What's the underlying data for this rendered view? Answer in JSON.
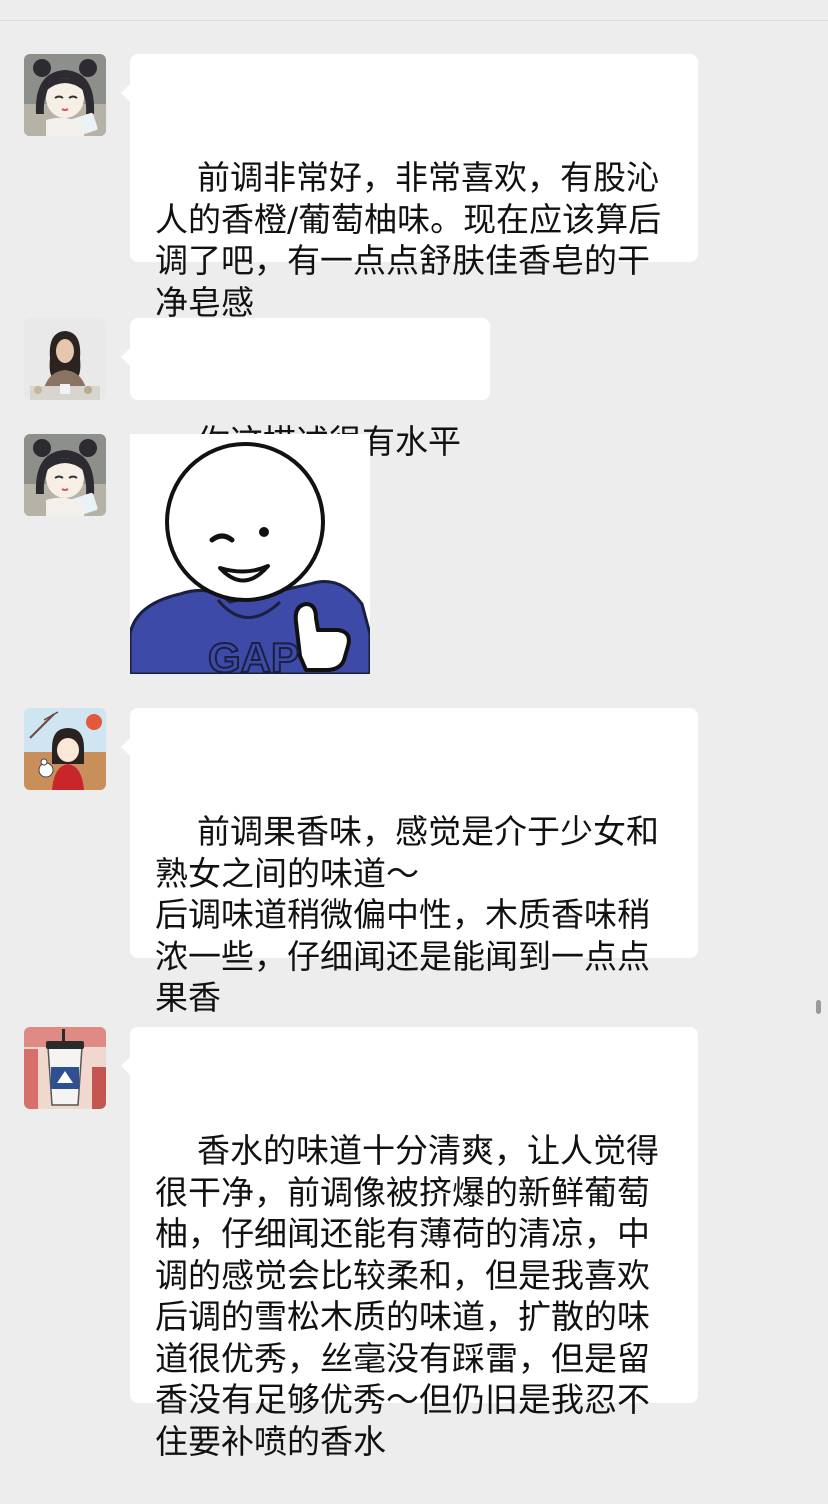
{
  "messages": [
    {
      "type": "text",
      "avatar": "avatar-anime-girl-icon",
      "text": "前调非常好，非常喜欢，有股沁人的香橙/葡萄柚味。现在应该算后调了吧，有一点点舒肤佳香皂的干净皂感"
    },
    {
      "type": "text",
      "avatar": "avatar-photo-woman-icon",
      "text": "你这描述很有水平啊"
    },
    {
      "type": "sticker",
      "avatar": "avatar-anime-girl-icon",
      "sticker": "thumbs-up-sticker-icon",
      "sticker_text": "GAP"
    },
    {
      "type": "text",
      "avatar": "avatar-illustrated-girl-icon",
      "text": "前调果香味，感觉是介于少女和熟女之间的味道～\n后调味道稍微偏中性，木质香味稍浓一些，仔细闻还是能闻到一点点果香"
    },
    {
      "type": "text",
      "avatar": "avatar-drink-cup-icon",
      "text": "香水的味道十分清爽，让人觉得很干净，前调像被挤爆的新鲜葡萄柚，仔细闻还能有薄荷的清凉，中调的感觉会比较柔和，但是我喜欢后调的雪松木质的味道，扩散的味道很优秀，丝毫没有踩雷，但是留香没有足够优秀～但仍旧是我忍不住要补喷的香水"
    }
  ],
  "colors": {
    "background": "#ededed",
    "bubble": "#ffffff",
    "sticker_hoodie": "#3d4aa8"
  }
}
